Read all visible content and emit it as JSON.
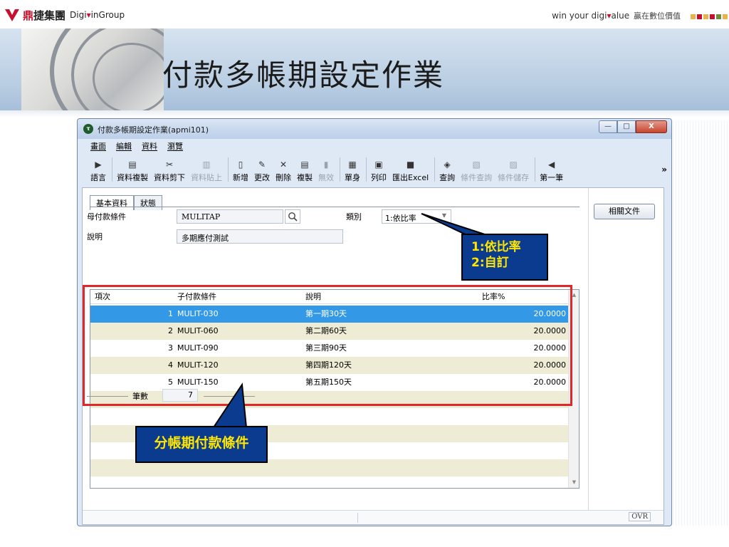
{
  "slide": {
    "logo_cn_red": "鼎",
    "logo_cn_rest": "捷集團",
    "logo_en_1": "Digi",
    "logo_en_2": "in",
    "logo_en_3": "Group",
    "tagline_1": "win your digi",
    "tagline_2": "alue",
    "tagline_cn": "贏在數位價值",
    "title": "付款多帳期設定作業",
    "square_colors": [
      "#e8b34a",
      "#c8102e",
      "#e8b34a",
      "#c8102e",
      "#6b8e3d",
      "#e8b34a"
    ]
  },
  "window": {
    "icon_text": "τ",
    "title": "付款多帳期設定作業(apmi101)",
    "btn_min": "—",
    "btn_max": "□",
    "btn_close": "X"
  },
  "menu": [
    "畫面",
    "編輯",
    "資料",
    "瀏覽"
  ],
  "toolbar": [
    {
      "icon": "▶",
      "label": "語言",
      "disabled": false
    },
    {
      "icon": "▤",
      "label": "資料複製",
      "disabled": false
    },
    {
      "icon": "✂",
      "label": "資料剪下",
      "disabled": false
    },
    {
      "icon": "▥",
      "label": "資料貼上",
      "disabled": true
    },
    {
      "icon": "▯",
      "label": "新增",
      "disabled": false
    },
    {
      "icon": "✎",
      "label": "更改",
      "disabled": false
    },
    {
      "icon": "✕",
      "label": "刪除",
      "disabled": false
    },
    {
      "icon": "▤",
      "label": "複製",
      "disabled": false
    },
    {
      "icon": "▮",
      "label": "無效",
      "disabled": true
    },
    {
      "icon": "▦",
      "label": "單身",
      "disabled": false
    },
    {
      "icon": "▣",
      "label": "列印",
      "disabled": false
    },
    {
      "icon": "■",
      "label": "匯出Excel",
      "disabled": false
    },
    {
      "icon": "◈",
      "label": "查詢",
      "disabled": false
    },
    {
      "icon": "▧",
      "label": "條件查詢",
      "disabled": true
    },
    {
      "icon": "▨",
      "label": "條件儲存",
      "disabled": true
    },
    {
      "icon": "◀",
      "label": "第一筆",
      "disabled": false
    }
  ],
  "toolbar_more": "»",
  "tabs": [
    "基本資料",
    "狀態"
  ],
  "form": {
    "parent_terms_label": "母付款條件",
    "parent_terms_value": "MULITAP",
    "category_label": "類別",
    "category_value": "1:依比率",
    "desc_label": "說明",
    "desc_value": "多期應付測試"
  },
  "related_docs": "相關文件",
  "grid": {
    "columns": [
      "項次",
      "子付款條件",
      "說明",
      "比率%"
    ],
    "rows": [
      {
        "no": "1",
        "code": "MULIT-030",
        "desc": "第一期30天",
        "rate": "20.0000"
      },
      {
        "no": "2",
        "code": "MULIT-060",
        "desc": "第二期60天",
        "rate": "20.0000"
      },
      {
        "no": "3",
        "code": "MULIT-090",
        "desc": "第三期90天",
        "rate": "20.0000"
      },
      {
        "no": "4",
        "code": "MULIT-120",
        "desc": "第四期120天",
        "rate": "20.0000"
      },
      {
        "no": "5",
        "code": "MULIT-150",
        "desc": "第五期150天",
        "rate": "20.0000"
      }
    ],
    "selected_row": 0,
    "empty_rows": 5
  },
  "count": {
    "label": "筆數",
    "value": "7"
  },
  "status": {
    "ovr": "OVR"
  },
  "callouts": {
    "category_line1": "1:依比率",
    "category_line2": "2:自訂",
    "grid_note": "分帳期付款條件"
  },
  "colors": {
    "accent_red": "#e0282a",
    "callout_bg": "#0a3b8f",
    "callout_text": "#ffe600",
    "selected_row": "#3399e6",
    "alt_row": "#eeecd5"
  }
}
